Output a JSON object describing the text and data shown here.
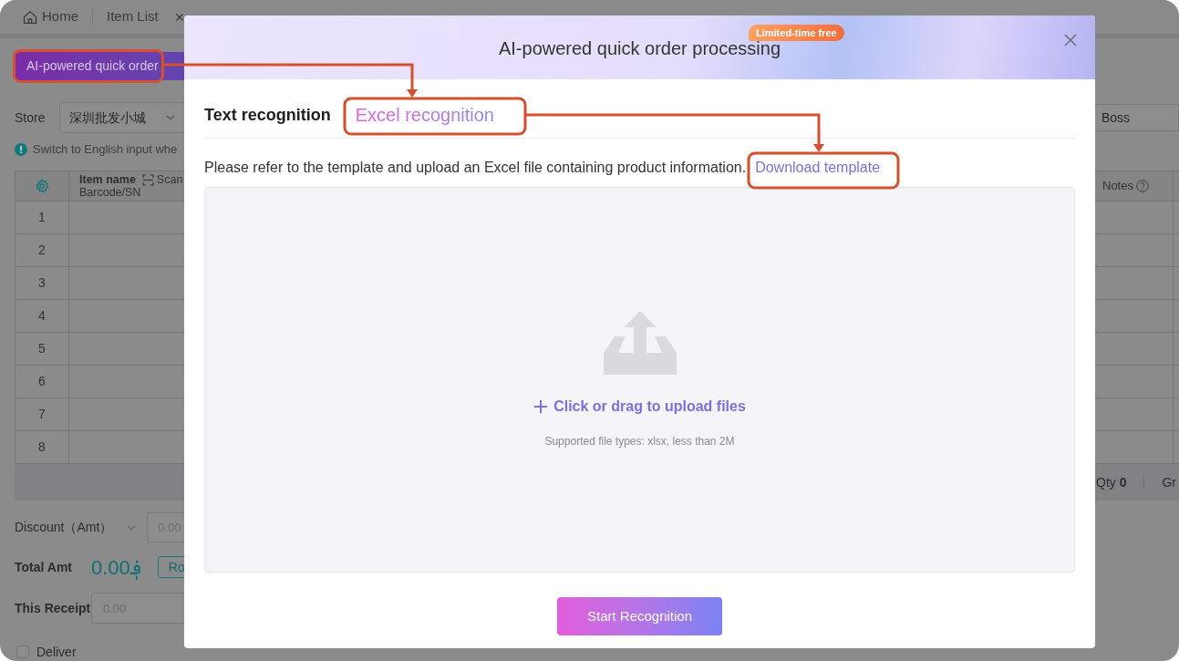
{
  "app": {
    "tabs": [
      {
        "label": "Home",
        "kind": "home"
      },
      {
        "label": "Item List",
        "kind": "closable"
      }
    ],
    "ai_button": "AI-powered quick order",
    "store": {
      "label": "Store",
      "value": "深圳批发小城"
    },
    "field_value": "Boss",
    "hint": "Switch to English input whe",
    "table": {
      "columns": [
        {
          "kind": "settings"
        },
        {
          "kind": "item",
          "label": "Item name",
          "sublabel": "Barcode/SN",
          "action": "Scan"
        },
        {
          "kind": "help",
          "label": "Notes"
        }
      ],
      "rows": [
        "1",
        "2",
        "3",
        "4",
        "5",
        "6",
        "7",
        "8"
      ],
      "footer": {
        "qty": "Qty **0**",
        "column_2": "Gr"
      }
    },
    "discount": {
      "label": "Discount（Amt）",
      "placeholder": "0.00"
    },
    "total": {
      "label": "Total Amt",
      "value": "0.00؋",
      "button": "Ro"
    },
    "receipt": {
      "label": "This Receipt",
      "placeholder": "0.00"
    },
    "deliver": {
      "label": "Deliver",
      "checked": false
    }
  },
  "dialog": {
    "title": "AI-powered quick order processing",
    "badge": "Limited-time free",
    "tabs": [
      {
        "label": "Text recognition",
        "selected": false
      },
      {
        "label": "Excel recognition",
        "selected": true
      }
    ],
    "description": "Please refer to the template and upload an Excel file containing product information.",
    "link": "Download template",
    "upload": {
      "prompt": "Click or drag to upload files",
      "hint": "Supported file types: xlsx, less than 2M"
    },
    "button": "Start Recognition"
  }
}
